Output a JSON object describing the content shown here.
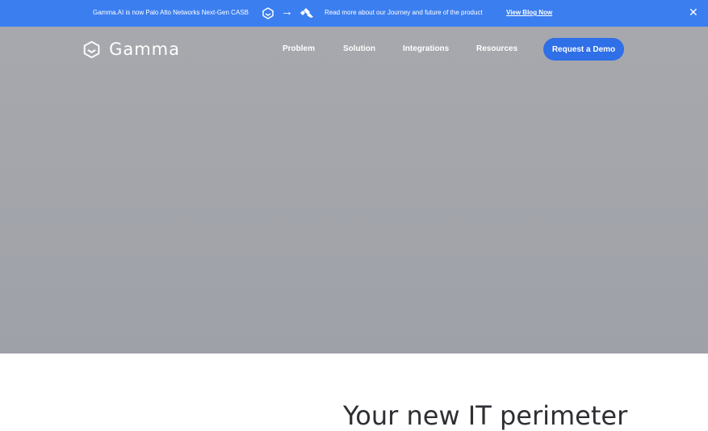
{
  "announcement": {
    "text": "Gamma.AI is now Palo Alto Networks Next-Gen CASB",
    "arrow": "→",
    "read_more": "Read more about our Journey and future of the product",
    "blog_link": "View Blog Now",
    "close": "✕"
  },
  "header": {
    "brand_name": "Gamma",
    "nav": [
      "Problem",
      "Solution",
      "Integrations",
      "Resources"
    ],
    "cta": "Request a Demo"
  },
  "main": {
    "headline": "Your new IT perimeter"
  },
  "colors": {
    "announce_bg": "#3b7ef0",
    "hero_bg": "#a3a5ab",
    "cta_bg": "#2f6fe8",
    "text_dark": "#2d2f33"
  }
}
